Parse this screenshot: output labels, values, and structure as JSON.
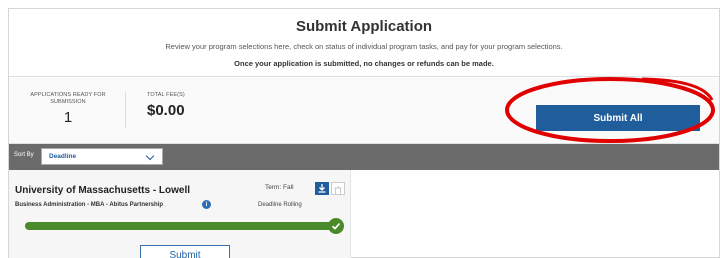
{
  "header": {
    "title": "Submit Application",
    "subtitle": "Review your program selections here, check on status of individual program tasks, and pay for your program selections.",
    "warning": "Once your application is submitted, no changes or refunds can be made."
  },
  "summary": {
    "applications_ready_label": "APPLICATIONS READY FOR SUBMISSION",
    "applications_ready_value": "1",
    "total_fees_label": "TOTAL FEE(S)",
    "total_fees_value": "$0.00"
  },
  "actions": {
    "submit_all_label": "Submit All"
  },
  "sort": {
    "label": "Sort By",
    "selected": "Deadline"
  },
  "application": {
    "school": "University of Massachusetts - Lowell",
    "term": "Term: Fall",
    "program": "Business Administration - MBA - Abitus Partnership",
    "deadline": "Deadline Rolling",
    "progress_percent": 100,
    "submit_label": "Submit"
  },
  "colors": {
    "primary": "#1f5d9c",
    "sortbar": "#6b6b6b",
    "progress": "#4a8a2a",
    "annotation": "#e00000"
  },
  "icons": [
    "download-icon",
    "trash-icon",
    "info-icon",
    "check-icon",
    "chevron-down-icon"
  ],
  "annotation": {
    "type": "hand-drawn red ellipse around Submit All button"
  }
}
